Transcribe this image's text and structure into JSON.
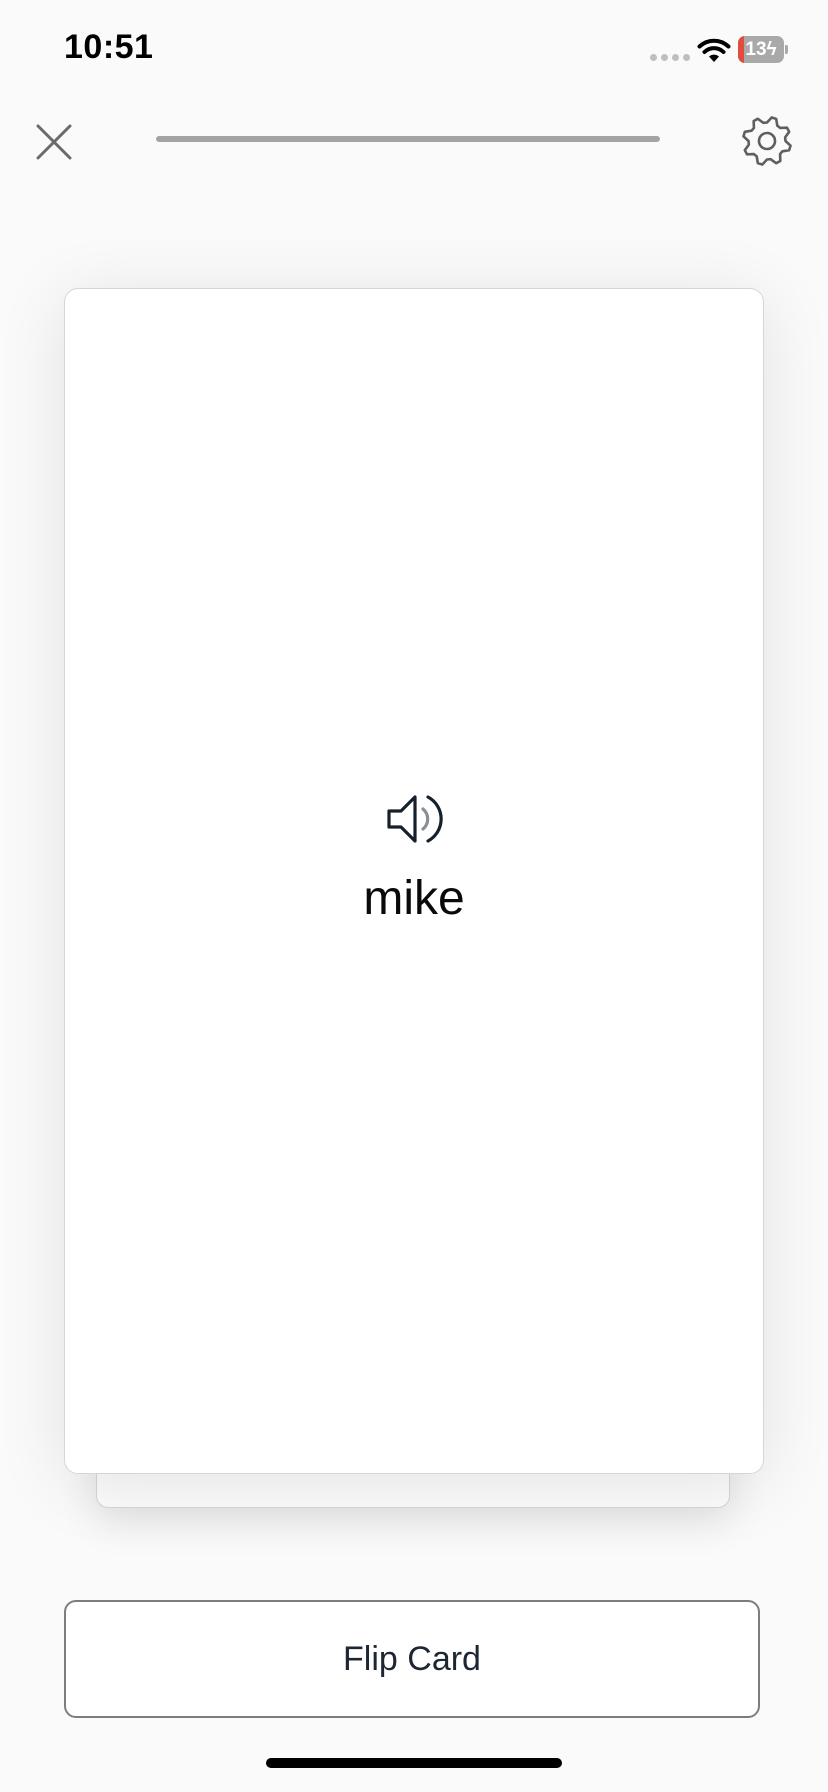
{
  "status_bar": {
    "time": "10:51",
    "battery_text": "13",
    "battery_level": 0.13,
    "battery_alert_color": "#e24b3f"
  },
  "top_bar": {
    "close_icon": "close-icon",
    "settings_icon": "gear-icon",
    "progress": 1.0
  },
  "card": {
    "audio_icon": "speaker-icon",
    "term": "mike"
  },
  "actions": {
    "flip_label": "Flip Card"
  },
  "colors": {
    "background": "#fafafa",
    "card": "#ffffff",
    "text": "#0a0a0a",
    "button_text": "#1d2733",
    "progress": "#a3a3a3"
  }
}
